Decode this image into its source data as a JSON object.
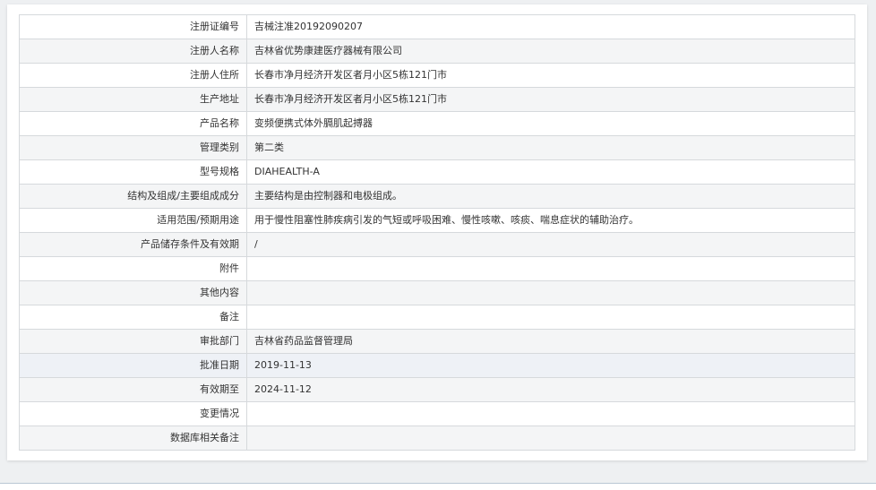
{
  "record": {
    "rows": [
      {
        "label": "注册证编号",
        "value": "吉械注准20192090207"
      },
      {
        "label": "注册人名称",
        "value": "吉林省优势康建医疗器械有限公司"
      },
      {
        "label": "注册人住所",
        "value": "长春市净月经济开发区者月小区5栋121门市"
      },
      {
        "label": "生产地址",
        "value": "长春市净月经济开发区者月小区5栋121门市"
      },
      {
        "label": "产品名称",
        "value": "变频便携式体外膈肌起搏器"
      },
      {
        "label": "管理类别",
        "value": "第二类"
      },
      {
        "label": "型号规格",
        "value": "DIAHEALTH-A"
      },
      {
        "label": "结构及组成/主要组成成分",
        "value": "主要结构是由控制器和电极组成。"
      },
      {
        "label": "适用范围/预期用途",
        "value": "用于慢性阻塞性肺疾病引发的气短或呼吸困难、慢性咳嗽、咳痰、喘息症状的辅助治疗。"
      },
      {
        "label": "产品储存条件及有效期",
        "value": "/"
      },
      {
        "label": "附件",
        "value": ""
      },
      {
        "label": "其他内容",
        "value": ""
      },
      {
        "label": "备注",
        "value": ""
      },
      {
        "label": "审批部门",
        "value": "吉林省药品监督管理局"
      },
      {
        "label": "批准日期",
        "value": "2019-11-13"
      },
      {
        "label": "有效期至",
        "value": "2024-11-12"
      },
      {
        "label": "变更情况",
        "value": ""
      },
      {
        "label": "数据库相关备注",
        "value": ""
      }
    ]
  },
  "colors": {
    "border": "#d6d9dc",
    "alt_row": "#f4f5f6",
    "hover_row": "#eef1f6",
    "text": "#333333"
  }
}
